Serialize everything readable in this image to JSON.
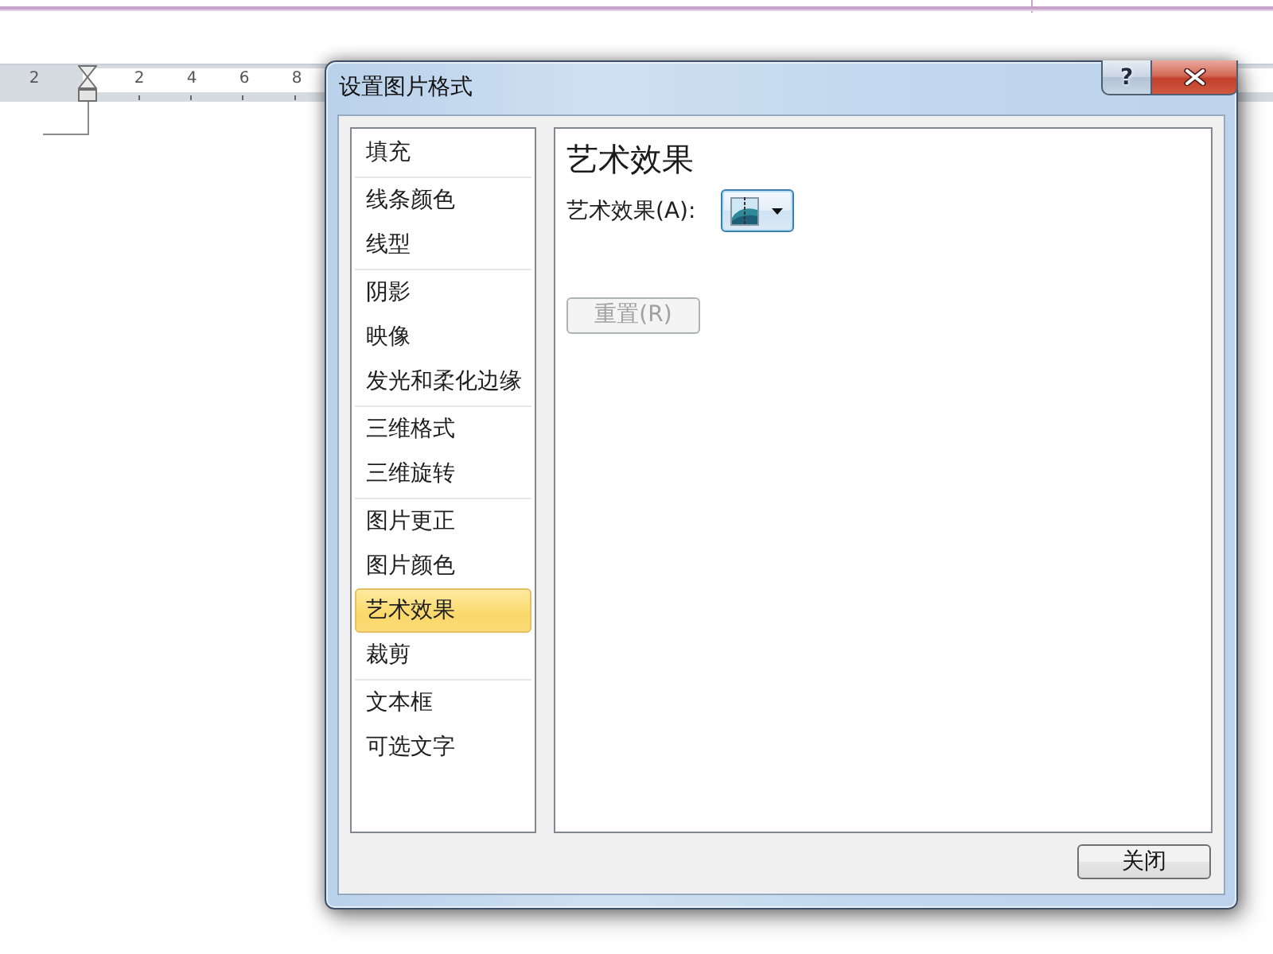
{
  "document": {
    "ruler": {
      "labels": [
        "2",
        "2",
        "4",
        "6",
        "8"
      ]
    }
  },
  "dialog": {
    "title": "设置图片格式",
    "help_button": "?",
    "sidebar": {
      "groups": [
        {
          "items": [
            {
              "label": "填充",
              "selected": false
            }
          ]
        },
        {
          "items": [
            {
              "label": "线条颜色",
              "selected": false
            },
            {
              "label": "线型",
              "selected": false
            }
          ]
        },
        {
          "items": [
            {
              "label": "阴影",
              "selected": false
            },
            {
              "label": "映像",
              "selected": false
            },
            {
              "label": "发光和柔化边缘",
              "selected": false
            }
          ]
        },
        {
          "items": [
            {
              "label": "三维格式",
              "selected": false
            },
            {
              "label": "三维旋转",
              "selected": false
            }
          ]
        },
        {
          "items": [
            {
              "label": "图片更正",
              "selected": false
            },
            {
              "label": "图片颜色",
              "selected": false
            },
            {
              "label": "艺术效果",
              "selected": true
            },
            {
              "label": "裁剪",
              "selected": false
            }
          ]
        },
        {
          "items": [
            {
              "label": "文本框",
              "selected": false
            },
            {
              "label": "可选文字",
              "selected": false
            }
          ]
        }
      ]
    },
    "panel": {
      "heading": "艺术效果",
      "effect_label": "艺术效果(A):",
      "reset_button": {
        "label": "重置(R)",
        "disabled": true
      }
    },
    "close_button": "关闭"
  }
}
